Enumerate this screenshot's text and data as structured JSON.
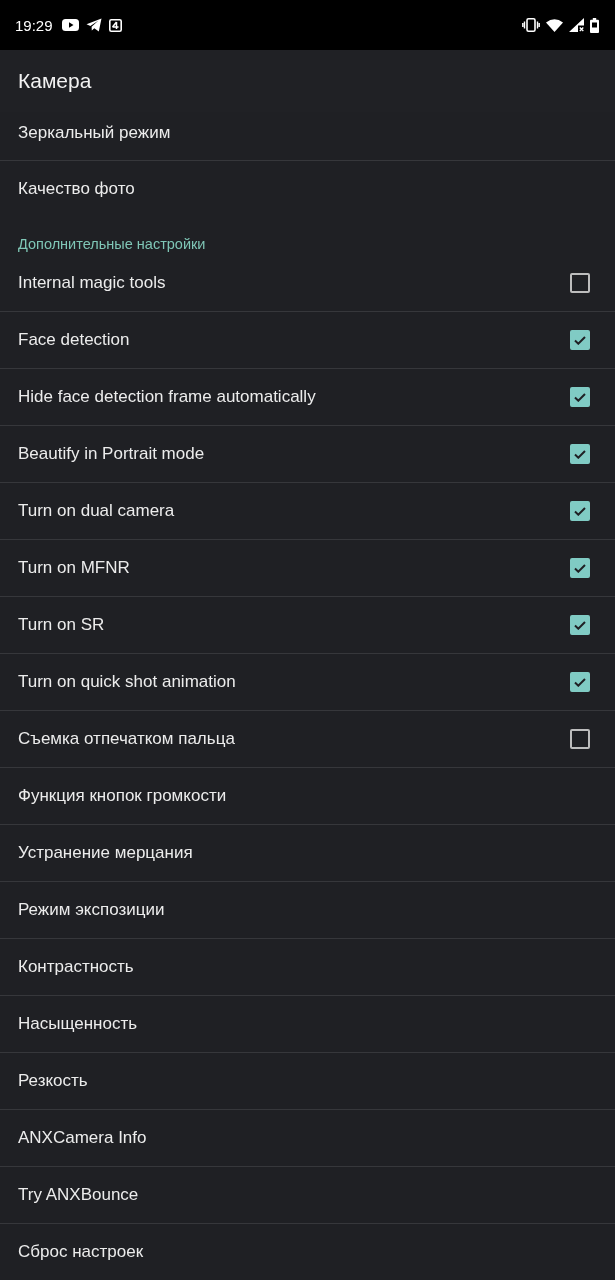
{
  "status_bar": {
    "time": "19:29"
  },
  "app_bar": {
    "title": "Камера"
  },
  "preferences": [
    {
      "kind": "item",
      "label": "Зеркальный режим"
    },
    {
      "kind": "item",
      "label": "Качество фото"
    },
    {
      "kind": "category",
      "label": "Дополнительные настройки"
    },
    {
      "kind": "checkbox",
      "label": "Internal magic tools",
      "checked": false
    },
    {
      "kind": "checkbox",
      "label": "Face detection",
      "checked": true
    },
    {
      "kind": "checkbox",
      "label": "Hide face detection frame automatically",
      "checked": true
    },
    {
      "kind": "checkbox",
      "label": "Beautify in Portrait mode",
      "checked": true
    },
    {
      "kind": "checkbox",
      "label": "Turn on dual camera",
      "checked": true
    },
    {
      "kind": "checkbox",
      "label": "Turn on MFNR",
      "checked": true
    },
    {
      "kind": "checkbox",
      "label": "Turn on SR",
      "checked": true
    },
    {
      "kind": "checkbox",
      "label": "Turn on quick shot animation",
      "checked": true
    },
    {
      "kind": "checkbox",
      "label": "Съемка отпечатком пальца",
      "checked": false
    },
    {
      "kind": "item",
      "label": "Функция кнопок громкости"
    },
    {
      "kind": "item",
      "label": "Устранение мерцания"
    },
    {
      "kind": "item",
      "label": "Режим экспозиции"
    },
    {
      "kind": "item",
      "label": "Контрастность"
    },
    {
      "kind": "item",
      "label": "Насыщенность"
    },
    {
      "kind": "item",
      "label": "Резкость"
    },
    {
      "kind": "item",
      "label": "ANXCamera Info"
    },
    {
      "kind": "item",
      "label": "Try ANXBounce"
    },
    {
      "kind": "item",
      "label": "Сброс настроек"
    }
  ]
}
